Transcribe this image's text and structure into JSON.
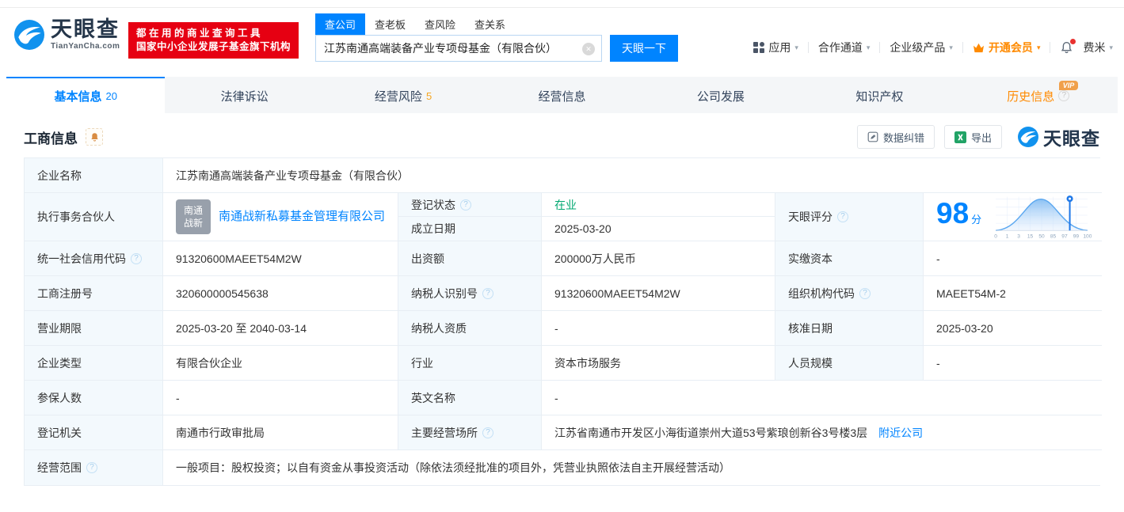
{
  "header": {
    "logo": {
      "brand": "天眼查",
      "domain": "TianYanCha.com"
    },
    "banner": {
      "line1": "都在用的商业查询工具",
      "line2": "国家中小企业发展子基金旗下机构"
    },
    "search": {
      "tabs": [
        "查公司",
        "查老板",
        "查风险",
        "查关系"
      ],
      "active_tab": "查公司",
      "input_value": "江苏南通高端装备产业专项母基金（有限合伙）",
      "button": "天眼一下"
    },
    "nav": {
      "apps": "应用",
      "cooperation": "合作通道",
      "enterprise": "企业级产品",
      "vip": "开通会员",
      "username": "费米"
    }
  },
  "page_tabs": [
    {
      "key": "basic",
      "label": "基本信息",
      "count": "20",
      "active": true
    },
    {
      "key": "legal",
      "label": "法律诉讼"
    },
    {
      "key": "risk",
      "label": "经营风险",
      "count": "5"
    },
    {
      "key": "operation",
      "label": "经营信息"
    },
    {
      "key": "development",
      "label": "公司发展"
    },
    {
      "key": "ip",
      "label": "知识产权"
    },
    {
      "key": "history",
      "label": "历史信息",
      "vip": true,
      "badge": "VIP",
      "help": true
    }
  ],
  "section": {
    "title": "工商信息",
    "correction_button": "数据纠错",
    "export_button": "导出",
    "watermark": "天眼查"
  },
  "registration": {
    "company_name_label": "企业名称",
    "company_name": "江苏南通高端装备产业专项母基金（有限合伙）",
    "partner_label": "执行事务合伙人",
    "partner_logo_line1": "南通",
    "partner_logo_line2": "战新",
    "partner_name": "南通战新私募基金管理有限公司",
    "status_label": "登记状态",
    "status_value": "在业",
    "established_label": "成立日期",
    "established_value": "2025-03-20",
    "score_label": "天眼评分",
    "score_value": "98",
    "score_unit": "分",
    "score_axis": [
      "0",
      "1",
      "3",
      "15",
      "50",
      "85",
      "97",
      "99",
      "100"
    ],
    "rows": [
      [
        {
          "label": "统一社会信用代码",
          "help": true,
          "value": "91320600MAEET54M2W"
        },
        {
          "label": "出资额",
          "value": "200000万人民币"
        },
        {
          "label": "实缴资本",
          "value": "-"
        }
      ],
      [
        {
          "label": "工商注册号",
          "value": "320600000545638"
        },
        {
          "label": "纳税人识别号",
          "help": true,
          "value": "91320600MAEET54M2W"
        },
        {
          "label": "组织机构代码",
          "help": true,
          "value": "MAEET54M-2"
        }
      ],
      [
        {
          "label": "营业期限",
          "value": "2025-03-20 至 2040-03-14"
        },
        {
          "label": "纳税人资质",
          "value": "-"
        },
        {
          "label": "核准日期",
          "value": "2025-03-20"
        }
      ],
      [
        {
          "label": "企业类型",
          "value": "有限合伙企业"
        },
        {
          "label": "行业",
          "value": "资本市场服务"
        },
        {
          "label": "人员规模",
          "value": "-"
        }
      ],
      [
        {
          "label": "参保人数",
          "value": "-"
        },
        {
          "label": "英文名称",
          "value": "-",
          "vspan": 3
        }
      ],
      [
        {
          "label": "登记机关",
          "value": "南通市行政审批局"
        },
        {
          "label": "主要经营场所",
          "help": true,
          "value": "江苏省南通市开发区小海街道崇州大道53号紫琅创新谷3号楼3层",
          "link": "附近公司",
          "vspan": 3
        }
      ],
      [
        {
          "label": "经营范围",
          "help": true,
          "value": "一般项目：股权投资；以自有资金从事投资活动（除依法须经批准的项目外，凭营业执照依法自主开展经营活动）",
          "vspan": 5
        }
      ]
    ]
  },
  "colors": {
    "brand_blue": "#0084ff",
    "status_green": "#00a870",
    "vip_orange": "#ff8a00",
    "banner_red": "#e60012",
    "excel_green": "#21a366"
  }
}
